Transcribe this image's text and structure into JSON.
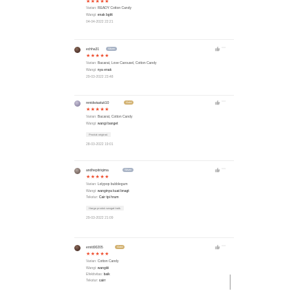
{
  "top_review": {
    "stars": "★★★★★",
    "variant_label": "Varian:",
    "variant": "READY Cotton Candy",
    "aroma_label": "Wangi:",
    "aroma": "enak bgttt",
    "date": "04-04-2022 22:21"
  },
  "reviews": [
    {
      "username": "echha31",
      "badge": "Silver",
      "stars": "★★★★★",
      "variant_label": "Varian:",
      "variant": "Bacarat, Love Carousel, Cotton Candy",
      "aroma_label": "Wangi:",
      "aroma": "nya enak",
      "date": "29-03-2022 23:48"
    },
    {
      "username": "renidwiastuti10",
      "badge": "Gold",
      "stars": "★★★★★",
      "variant_label": "Varian:",
      "variant": "Bacarat, Cotton Candy",
      "aroma_label": "Wangi:",
      "aroma": "wangi banget",
      "reply": "Produk original.",
      "date": "28-03-2022 19:01"
    },
    {
      "username": "andhepitriqima",
      "badge": "Silver",
      "stars": "★★★★★",
      "variant_label": "Varian:",
      "variant": "Lolypop bubblegum",
      "aroma_label": "Wangi:",
      "aroma": "wanginya kuat bnagt",
      "texture_label": "Tekstur:",
      "texture": "Cair tpi hrum",
      "reply": "Harga produk sangat baik.",
      "date": "29-03-2022 21:09"
    },
    {
      "username": "erniti90205",
      "badge": "Gold",
      "stars": "★★★★★",
      "variant_label": "Varian:",
      "variant": "Cotton Candy",
      "aroma_label": "Wangi:",
      "aroma": "wangiiii",
      "effect_label": "Efektivitas:",
      "effect": "baik",
      "texture_label": "Tekstur:",
      "texture": "cairr"
    }
  ],
  "icons": {
    "like": "thumbs-up-icon",
    "more": "more-options-icon"
  },
  "colors": {
    "star": "#ee4d2d",
    "silver_badge": "#a9b4c6",
    "gold_badge": "#d2b170"
  }
}
